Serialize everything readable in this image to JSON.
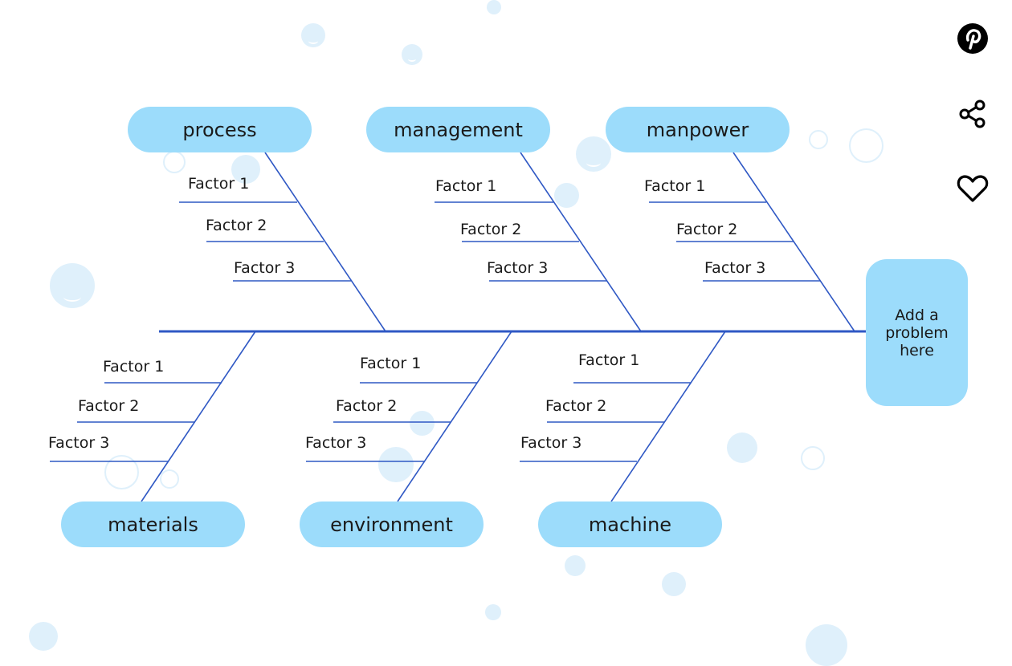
{
  "diagram": {
    "type": "fishbone",
    "problem_label": "Add a problem here",
    "categories": [
      {
        "name": "process",
        "position": "top",
        "factors": [
          "Factor 1",
          "Factor 2",
          "Factor 3"
        ]
      },
      {
        "name": "management",
        "position": "top",
        "factors": [
          "Factor 1",
          "Factor 2",
          "Factor 3"
        ]
      },
      {
        "name": "manpower",
        "position": "top",
        "factors": [
          "Factor 1",
          "Factor 2",
          "Factor 3"
        ]
      },
      {
        "name": "materials",
        "position": "bottom",
        "factors": [
          "Factor 1",
          "Factor 2",
          "Factor 3"
        ]
      },
      {
        "name": "environment",
        "position": "bottom",
        "factors": [
          "Factor 1",
          "Factor 2",
          "Factor 3"
        ]
      },
      {
        "name": "machine",
        "position": "bottom",
        "factors": [
          "Factor 1",
          "Factor 2",
          "Factor 3"
        ]
      }
    ]
  },
  "side_actions": [
    {
      "name": "pinterest",
      "icon": "pinterest-icon"
    },
    {
      "name": "share",
      "icon": "share-icon"
    },
    {
      "name": "favorite",
      "icon": "heart-icon"
    }
  ],
  "colors": {
    "box_fill": "#9cdcfb",
    "line": "#2f58c4",
    "bubble": "#dff0fb",
    "text": "#1a1a1a"
  }
}
